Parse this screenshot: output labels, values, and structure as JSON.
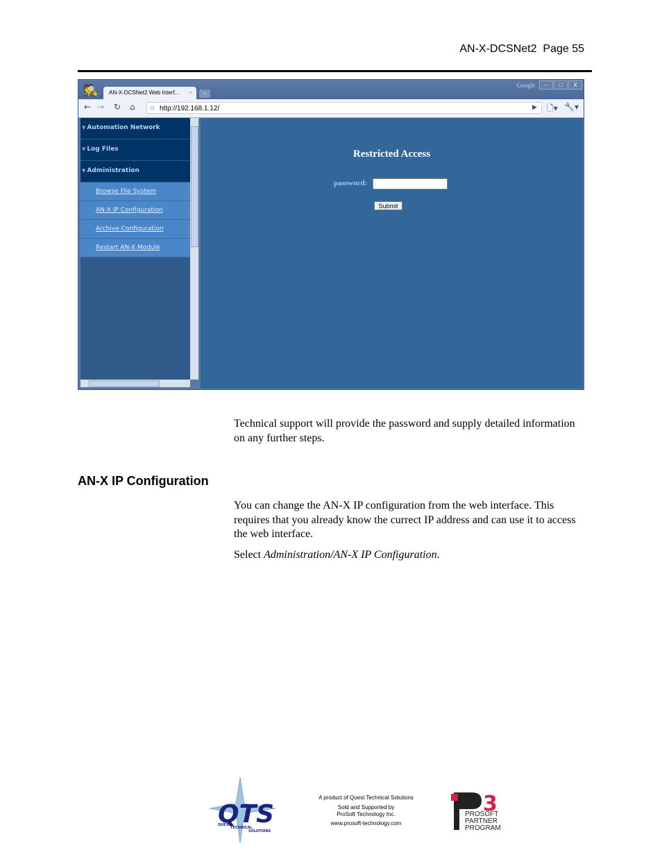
{
  "header": {
    "doc_title": "AN-X-DCSNet2",
    "page": "Page 55"
  },
  "browser": {
    "tab_title": "AN-X-DCSNet2 Web Interf...",
    "tab_close": "×",
    "new_tab": "+",
    "google_label": "Google",
    "window_buttons": [
      "–",
      "□",
      "X"
    ],
    "url": "http://192.168.1.12/",
    "sidebar": {
      "sections": [
        "Automation Network",
        "Log Files",
        "Administration"
      ],
      "admin_items": [
        "Browse File System",
        "AN-X IP Configuration",
        "Archive Configuration",
        "Restart AN-X Module"
      ]
    },
    "main": {
      "title": "Restricted Access",
      "password_label": "password:",
      "password_value": "",
      "submit_label": "Submit"
    },
    "colors": {
      "sidebar": "#003366",
      "submenu": "#4a87c9",
      "content": "#336699"
    }
  },
  "body": {
    "para1": "Technical support will provide the password and supply detailed information on any further steps.",
    "heading": "AN-X IP Configuration",
    "para2": "You can change the AN-X IP configuration from the web interface.  This requires that you already know the currect IP address and can use it to access the web interface.",
    "para3_prefix": "Select ",
    "para3_italic": "Administration/AN-X IP Configuration",
    "para3_suffix": "."
  },
  "footer": {
    "line1": "A product of Quest Technical Solutions",
    "line2": "Sold and Supported by",
    "line3": "ProSoft Technology Inc.",
    "line4": "www.prosoft-technology.com",
    "qts_logo": "QTS Quest Technical Solutions",
    "p3_logo": "P3 PROSOFT PARTNER PROGRAM"
  }
}
